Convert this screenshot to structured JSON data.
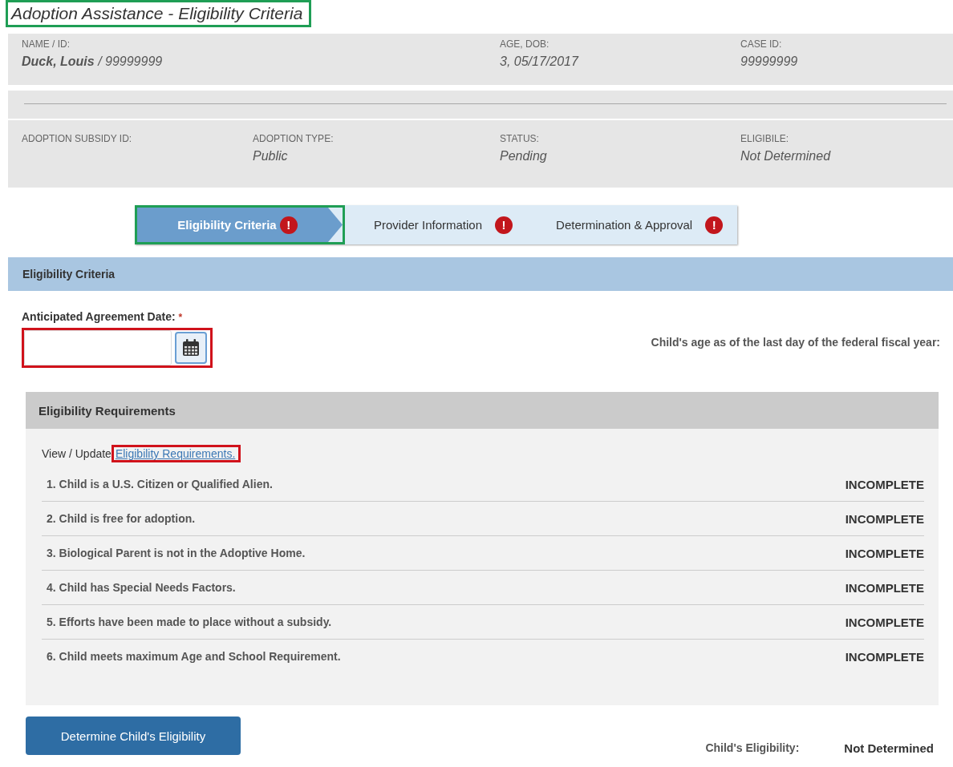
{
  "page_title": "Adoption Assistance - Eligibility Criteria",
  "summary_rows": [
    [
      {
        "label": "NAME / ID:",
        "value": "**Duck, Louis** / 99999999"
      },
      {
        "label": "AGE, DOB:",
        "value": "3, 05/17/2017"
      },
      {
        "label": "CASE ID:",
        "value": "99999999"
      }
    ],
    [
      {
        "label": "ADOPTION SUBSIDY ID:"
      },
      {
        "label": "ADOPTION TYPE:",
        "value": "Public"
      },
      {
        "label": "STATUS:",
        "value": "Pending"
      },
      {
        "label": "ELIGIBILE:",
        "value": "Not Determined"
      }
    ]
  ],
  "steps": [
    {
      "label": "Eligibility Criteria",
      "selected": true,
      "alert": true,
      "alert_icon": "!"
    },
    {
      "label": "Provider Information",
      "selected": false,
      "alert": true,
      "alert_icon": "!"
    },
    {
      "label": "Determination & Approval",
      "selected": false,
      "alert": true,
      "alert_icon": "!"
    }
  ],
  "section_title": "Eligibility Criteria",
  "date_field": {
    "label": "Anticipated Agreement Date:",
    "required_mark": "*"
  },
  "age_note": "Child's age as of the last day of the federal fiscal year:",
  "requirements": {
    "title": "Eligibility Requirements",
    "link_prefix": "View / Update",
    "link": "Eligibility Requirements.",
    "items": [
      {
        "text": "1. Child is a U.S. Citizen or Qualified Alien.",
        "status": "INCOMPLETE"
      },
      {
        "text": "2. Child is free for adoption.",
        "status": "INCOMPLETE"
      },
      {
        "text": "3. Biological Parent is not in the Adoptive Home.",
        "status": "INCOMPLETE"
      },
      {
        "text": "4. Child has Special Needs Factors.",
        "status": "INCOMPLETE"
      },
      {
        "text": "5. Efforts have been made to place without a subsidy.",
        "status": "INCOMPLETE"
      },
      {
        "text": "6. Child meets maximum Age and School Requirement.",
        "status": "INCOMPLETE"
      }
    ]
  },
  "determine_button": "Determine Child's Eligibility",
  "result": {
    "label": "Child's Eligibility:",
    "value": "Not Determined"
  }
}
